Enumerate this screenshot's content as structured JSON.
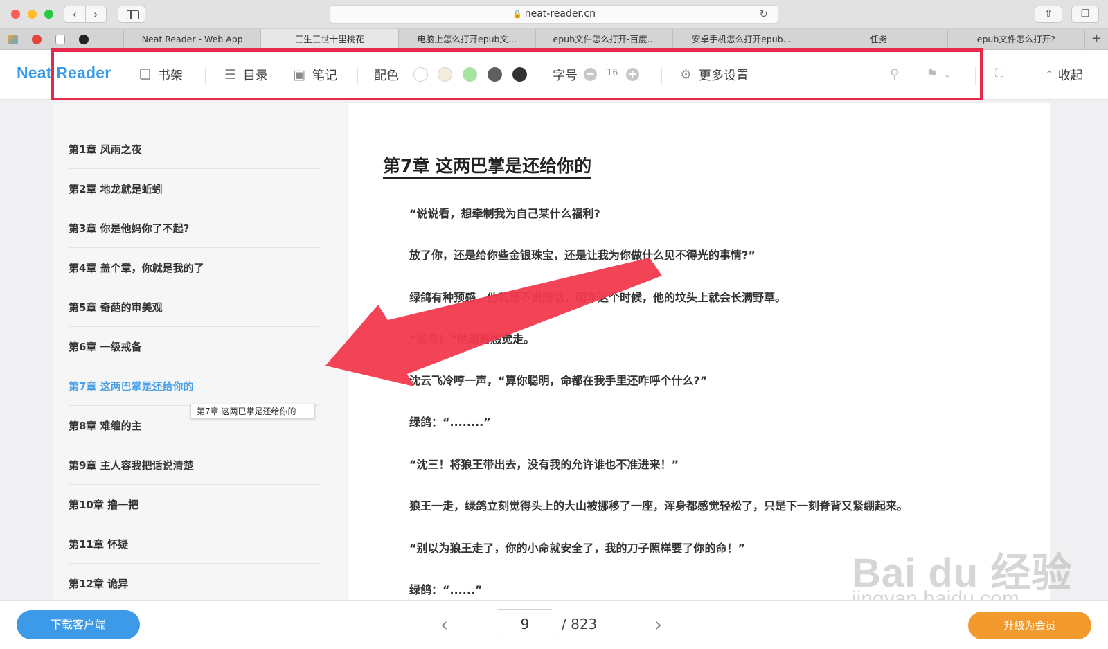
{
  "browser": {
    "url": "neat-reader.cn",
    "tabs": [
      {
        "label": "Neat Reader - Web App",
        "active": false
      },
      {
        "label": "三生三世十里桃花",
        "active": true
      },
      {
        "label": "电脑上怎么打开epub文...",
        "active": false
      },
      {
        "label": "epub文件怎么打开-百度...",
        "active": false
      },
      {
        "label": "安卓手机怎么打开epub...",
        "active": false
      },
      {
        "label": "任务",
        "active": false
      },
      {
        "label": "epub文件怎么打开?",
        "active": false
      }
    ]
  },
  "toolbar": {
    "logo": "Neat Reader",
    "bookshelf": "书架",
    "toc": "目录",
    "notes": "笔记",
    "color_label": "配色",
    "swatches": [
      "#ffffff",
      "#f3ecd9",
      "#a9e3a2",
      "#5f5f5f",
      "#333333"
    ],
    "font_label": "字号",
    "font_size": "16",
    "more_settings": "更多设置",
    "collapse": "收起",
    "highlight_color": "#e8284a"
  },
  "toc": {
    "items": [
      "第1章 风雨之夜",
      "第2章 地龙就是蚯蚓",
      "第3章 你是他妈你了不起?",
      "第4章 盖个章，你就是我的了",
      "第5章 奇葩的审美观",
      "第6章 一级戒备",
      "第7章 这两巴掌是还给你的",
      "第8章 难缠的主",
      "第9章 主人容我把话说清楚",
      "第10章 撸一把",
      "第11章 怀疑",
      "第12章 诡异"
    ],
    "active_index": 6,
    "tooltip": "第7章 这两巴掌是还给你的"
  },
  "reader": {
    "chapter_title": "第7章 这两巴掌是还给你的",
    "paragraphs": [
      "“说说看，想牵制我为自己某什么福利?",
      "放了你，还是给你些金银珠宝，还是让我为你做什么见不得光的事情?”",
      "绿鸽有种预感，他若是不说的话，明年这个时候，他的坟头上就会长满野草。",
      "“没有！”他跟着感觉走。",
      "沈云飞冷哼一声，“算你聪明，命都在我手里还咋呼个什么?”",
      "绿鸽：“........”",
      "“沈三！将狼王带出去，没有我的允许谁也不准进来！”",
      "狼王一走，绿鸽立刻觉得头上的大山被挪移了一座，浑身都感觉轻松了，只是下一刻脊背又紧绷起来。",
      "“别以为狼王走了，你的小命就安全了，我的刀子照样要了你的命！”",
      "绿鸽：“......”"
    ]
  },
  "footer": {
    "download": "下载客户端",
    "current_page": "9",
    "total_pages": "/ 823",
    "upgrade": "升级为会员"
  },
  "watermark": {
    "main": "Bai du 经验",
    "sub": "jingyan.baidu.com"
  },
  "annotation": {
    "arrow_color": "#f23a4e"
  }
}
